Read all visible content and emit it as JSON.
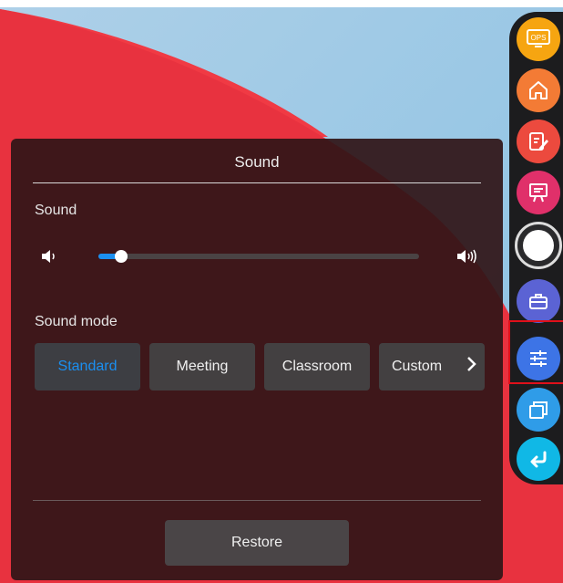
{
  "panel": {
    "title": "Sound",
    "sound_label": "Sound",
    "volume_level": 0.07,
    "sound_mode_label": "Sound mode",
    "modes": [
      {
        "label": "Standard",
        "selected": true
      },
      {
        "label": "Meeting",
        "selected": false
      },
      {
        "label": "Classroom",
        "selected": false
      },
      {
        "label": "Custom",
        "selected": false
      }
    ],
    "restore_label": "Restore"
  },
  "dock": {
    "ops_text": "OPS",
    "items": [
      {
        "icon": "ops-icon",
        "color": "#f6a511"
      },
      {
        "icon": "home-icon",
        "color": "#f37b35"
      },
      {
        "icon": "note-edit-icon",
        "color": "#ec4a3e"
      },
      {
        "icon": "whiteboard-icon",
        "color": "#e0306a"
      },
      {
        "icon": "circle-shortcut-icon",
        "color": "#ffffff"
      },
      {
        "icon": "toolbox-icon",
        "color": "#5b63d4"
      },
      {
        "icon": "settings-sliders-icon",
        "color": "#3d74e6"
      },
      {
        "icon": "windows-icon",
        "color": "#2f9ce8"
      },
      {
        "icon": "back-icon",
        "color": "#10b8e6"
      }
    ]
  },
  "colors": {
    "accent": "#1b8ff0",
    "panel_bg": "#301618",
    "highlight_border": "#e0101a"
  }
}
